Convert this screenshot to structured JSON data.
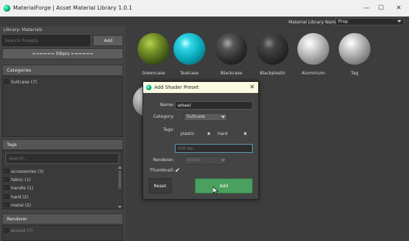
{
  "window": {
    "title": "MaterialForge | Asset Material Library 1.0.1",
    "minimize": "—",
    "maximize": "☐",
    "close": "✕"
  },
  "toolbar": {
    "library_name_label": "Material Library Name:",
    "library_name_value": "Prop"
  },
  "sidebar": {
    "library_label": "Library: Materials",
    "search_placeholder": "Search Presets",
    "add_button": "Add",
    "filters_label": "====== Filters ======",
    "categories_header": "Categories",
    "categories": [
      {
        "label": "Suitcase (7)"
      }
    ],
    "tags_header": "Tags",
    "tags_search_placeholder": "Search...",
    "tags": [
      {
        "label": "accessories (3)"
      },
      {
        "label": "fabric (1)"
      },
      {
        "label": "handle (1)"
      },
      {
        "label": "hard (2)"
      },
      {
        "label": "metal (2)"
      }
    ],
    "renderer_header": "Renderer",
    "renderers": [
      {
        "label": "Arnold (7)"
      }
    ]
  },
  "materials": [
    {
      "name": "Greencase",
      "color": "#6f8d25"
    },
    {
      "name": "Tealcase",
      "color": "#0aa7b8"
    },
    {
      "name": "Blackcase",
      "color": "#2a2a2a"
    },
    {
      "name": "Blackplastic",
      "color": "#282828"
    },
    {
      "name": "Aluminium",
      "color": "#d6d6d6"
    },
    {
      "name": "Tag",
      "color": "#cfcfcf"
    }
  ],
  "dialog": {
    "title": "Add Shader Preset",
    "close": "✕",
    "name_label": "Name:",
    "name_value": "wheel",
    "category_label": "Category:",
    "category_value": "Suitcase",
    "tags_label": "Tags:",
    "tags": [
      {
        "label": "plastic",
        "remove": "x"
      },
      {
        "label": "hard",
        "remove": "x"
      }
    ],
    "add_tag_placeholder": "Add tag...",
    "renderer_label": "Renderer:",
    "renderer_value": "Arnold",
    "thumbnail_label": "Thumbnail:",
    "thumbnail_check": "✔",
    "reset_button": "Reset",
    "add_button": "Add"
  },
  "colors": {
    "accent_green": "#4aa05e",
    "focus_blue": "#5aa0b5",
    "dialog_title_bg": "#fbfbe2"
  }
}
